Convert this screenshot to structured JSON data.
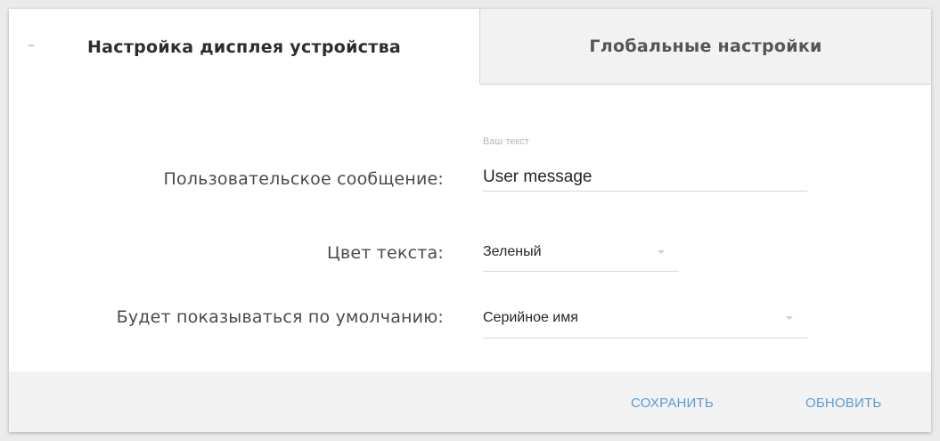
{
  "tabs": [
    {
      "label": "Настройка дисплея устройства",
      "active": true
    },
    {
      "label": "Глобальные настройки",
      "active": false
    }
  ],
  "form": {
    "user_message": {
      "label": "Пользовательское сообщение:",
      "floating_label": "Ваш текст",
      "value": "User message"
    },
    "text_color": {
      "label": "Цвет текста:",
      "value": "Зеленый"
    },
    "default_display": {
      "label": "Будет показываться по умолчанию:",
      "value": "Серийное имя"
    }
  },
  "actions": {
    "save_label": "СОХРАНИТЬ",
    "refresh_label": "ОБНОВИТЬ"
  },
  "colors": {
    "accent": "#5b9bd5",
    "footer_bg": "#f2f2f2",
    "inactive_tab_bg": "#f2f2f2"
  }
}
